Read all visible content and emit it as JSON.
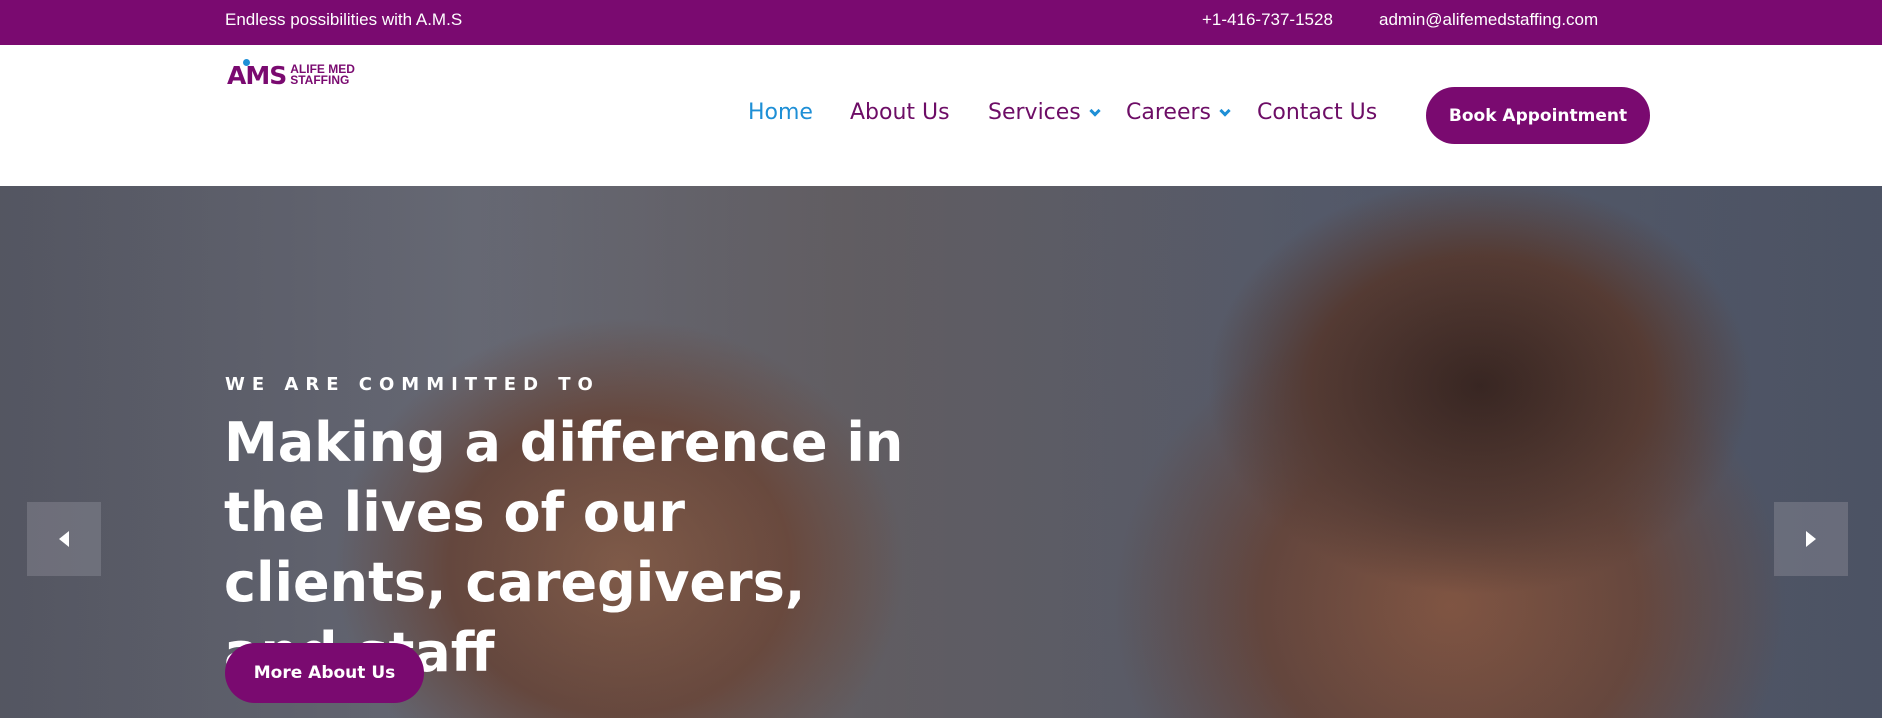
{
  "topbar": {
    "tagline": "Endless possibilities with A.M.S",
    "phone": "+1-416-737-1528",
    "email": "admin@alifemedstaffing.com"
  },
  "logo": {
    "mark": "AMS",
    "line1": "ALIFE MED",
    "line2": "STAFFING"
  },
  "nav": {
    "items": [
      {
        "label": "Home",
        "active": true
      },
      {
        "label": "About Us"
      },
      {
        "label": "Services",
        "dropdown": true
      },
      {
        "label": "Careers",
        "dropdown": true
      },
      {
        "label": "Contact Us"
      }
    ],
    "cta": "Book Appointment"
  },
  "hero": {
    "kicker": "WE ARE COMMITTED TO",
    "title": "Making a difference in the lives of our clients, caregivers, and staff",
    "button": "More About Us",
    "prev_icon": "caret-left-icon",
    "next_icon": "caret-right-icon"
  },
  "colors": {
    "brand": "#7a0a70",
    "accent": "#1e8fd6",
    "nav_text": "#6d0d66"
  }
}
